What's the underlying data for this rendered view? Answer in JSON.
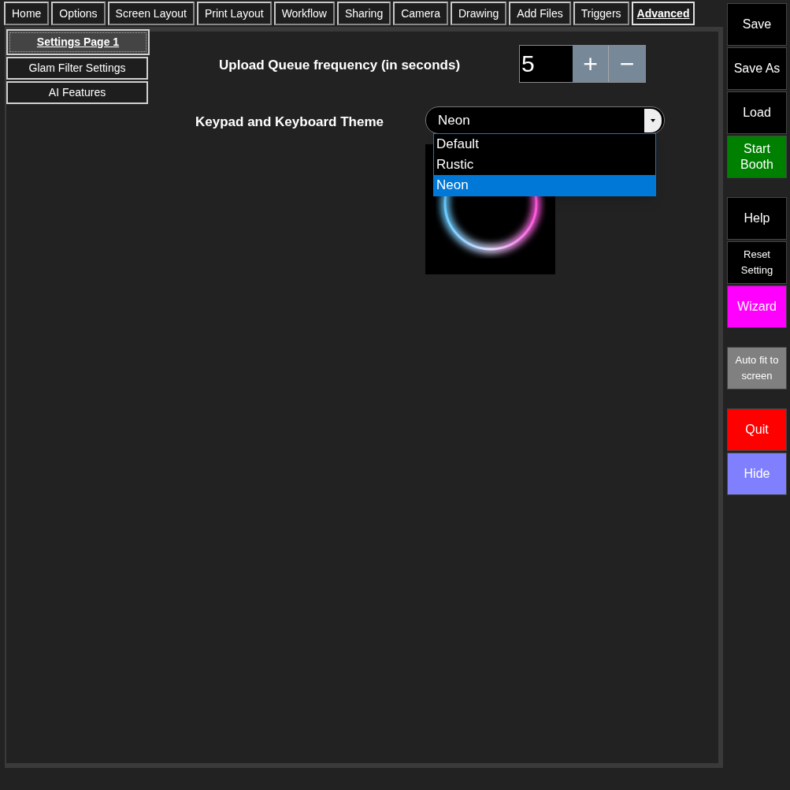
{
  "tabs": [
    {
      "label": "Home",
      "selected": false
    },
    {
      "label": "Options",
      "selected": false
    },
    {
      "label": "Screen Layout",
      "selected": false
    },
    {
      "label": "Print Layout",
      "selected": false
    },
    {
      "label": "Workflow",
      "selected": false
    },
    {
      "label": "Sharing",
      "selected": false
    },
    {
      "label": "Camera",
      "selected": false
    },
    {
      "label": "Drawing",
      "selected": false
    },
    {
      "label": "Add Files",
      "selected": false
    },
    {
      "label": "Triggers",
      "selected": false
    },
    {
      "label": "Advanced",
      "selected": true
    }
  ],
  "subtabs": [
    {
      "label": "Settings Page 1",
      "selected": true
    },
    {
      "label": "Glam Filter Settings",
      "selected": false
    },
    {
      "label": "AI Features",
      "selected": false
    }
  ],
  "upload_queue": {
    "label": "Upload Queue frequency (in seconds)",
    "value": "5",
    "increment": "+",
    "decrement": "−"
  },
  "keypad_theme": {
    "label": "Keypad and Keyboard Theme",
    "value": "Neon",
    "expanded": true,
    "options": [
      {
        "label": "Default",
        "selected": false
      },
      {
        "label": "Rustic",
        "selected": false
      },
      {
        "label": "Neon",
        "selected": true
      }
    ]
  },
  "sidebar": {
    "groups": [
      [
        {
          "label": "Save",
          "color": "#000000"
        },
        {
          "label": "Save As",
          "color": "#000000"
        },
        {
          "label": "Load",
          "color": "#000000"
        },
        {
          "label": "Start Booth",
          "color": "#008000"
        }
      ],
      [
        {
          "label": "Help",
          "color": "#000000"
        },
        {
          "label": "Reset Setting",
          "color": "#000000"
        },
        {
          "label": "Wizard",
          "color": "#ff00ff"
        }
      ],
      [
        {
          "label": "Auto fit to screen",
          "color": "#808080"
        }
      ],
      [
        {
          "label": "Quit",
          "color": "#ff0000"
        },
        {
          "label": "Hide",
          "color": "#8080ff"
        }
      ]
    ]
  }
}
